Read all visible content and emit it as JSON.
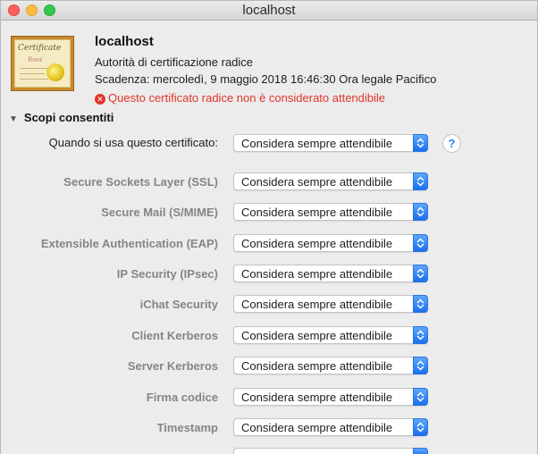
{
  "window": {
    "title": "localhost"
  },
  "cert": {
    "icon_name": "certificate-icon",
    "icon_text_1": "Certificate",
    "icon_text_2": "Root",
    "name": "localhost",
    "type": "Autorità di certificazione radice",
    "expiry": "Scadenza: mercoledì, 9 maggio 2018 16:46:30 Ora legale Pacifico",
    "error": "Questo certificato radice non è considerato attendibile",
    "error_color": "#e0352b"
  },
  "section": {
    "title": "Scopi consentiti"
  },
  "main_row": {
    "label": "Quando si usa questo certificato:",
    "value": "Considera sempre attendibile"
  },
  "help": {
    "label": "?"
  },
  "rows": [
    {
      "label": "Secure Sockets Layer (SSL)",
      "value": "Considera sempre attendibile"
    },
    {
      "label": "Secure Mail (S/MIME)",
      "value": "Considera sempre attendibile"
    },
    {
      "label": "Extensible Authentication (EAP)",
      "value": "Considera sempre attendibile"
    },
    {
      "label": "IP Security (IPsec)",
      "value": "Considera sempre attendibile"
    },
    {
      "label": "iChat Security",
      "value": "Considera sempre attendibile"
    },
    {
      "label": "Client Kerberos",
      "value": "Considera sempre attendibile"
    },
    {
      "label": "Server Kerberos",
      "value": "Considera sempre attendibile"
    },
    {
      "label": "Firma codice",
      "value": "Considera sempre attendibile"
    },
    {
      "label": "Timestamp",
      "value": "Considera sempre attendibile"
    }
  ],
  "accent_color": "#2f7cf6"
}
